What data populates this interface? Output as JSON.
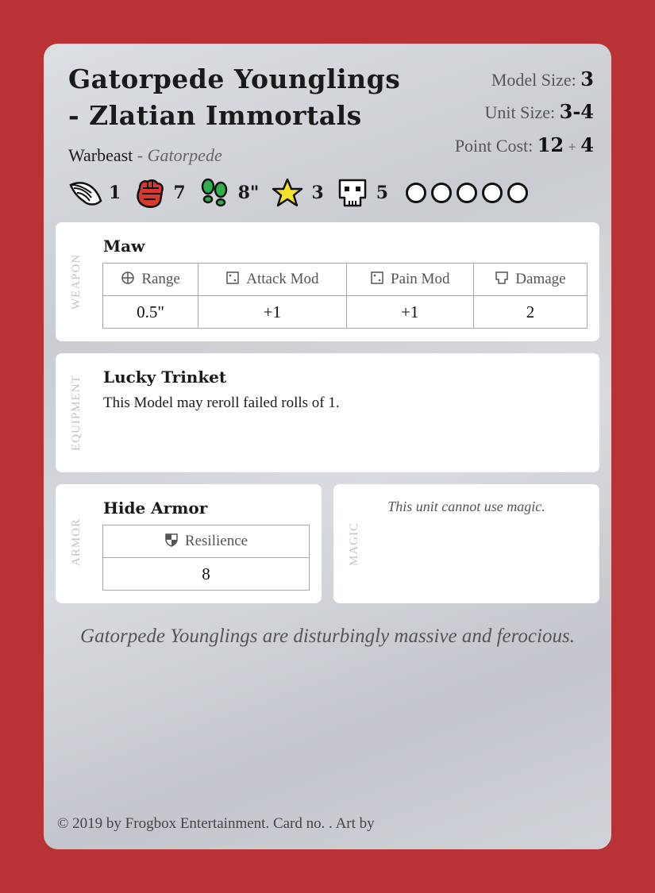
{
  "card": {
    "title": "Gatorpede Younglings - Zlatian Immortals",
    "kind": "Warbeast",
    "separator": "-",
    "type": "Gatorpede",
    "model_size_label": "Model Size:",
    "model_size": "3",
    "unit_size_label": "Unit Size:",
    "unit_size": "3-4",
    "point_cost_label": "Point Cost:",
    "point_cost": "12",
    "point_plus": "+",
    "point_extra": "4"
  },
  "stats": {
    "speed": "1",
    "strength": "7",
    "move": "8\"",
    "star": "3",
    "health": "5"
  },
  "weapon": {
    "section_label": "WEAPON",
    "name": "Maw",
    "headers": [
      "Range",
      "Attack Mod",
      "Pain Mod",
      "Damage"
    ],
    "values": [
      "0.5\"",
      "+1",
      "+1",
      "2"
    ]
  },
  "equipment": {
    "section_label": "EQUIPMENT",
    "name": "Lucky Trinket",
    "text": "This Model may reroll failed rolls of 1."
  },
  "armor": {
    "section_label": "ARMOR",
    "name": "Hide Armor",
    "header": "Resilience",
    "value": "8"
  },
  "magic": {
    "section_label": "MAGIC",
    "text": "This unit cannot use magic."
  },
  "flavor": "Gatorpede Younglings are disturbingly massive and ferocious.",
  "footer": "© 2019 by Frogbox Entertainment. Card no. . Art by",
  "colors": {
    "background": "#b93236",
    "fist": "#d63a2e",
    "feet": "#2fae4f",
    "star": "#f5e12a"
  }
}
